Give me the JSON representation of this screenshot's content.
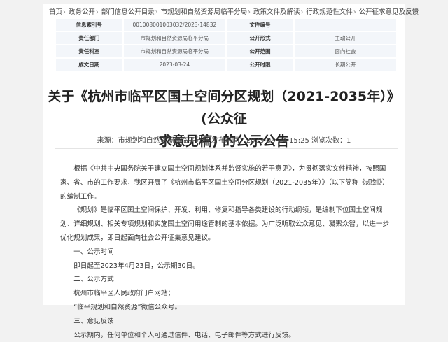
{
  "breadcrumb": [
    "首页",
    "政务公开",
    "部门信息公开目录",
    "市规划和自然资源局临平分局",
    "政策文件及解读",
    "行政规范性文件",
    "公开征求意见及反馈"
  ],
  "meta_table": [
    [
      "信息索引号",
      "001008001003032/2023-14832",
      "文件编号",
      ""
    ],
    [
      "责任部门",
      "市规划和自然资源局临平分局",
      "公开形式",
      "主动公开"
    ],
    [
      "责任科室",
      "市规划和自然资源局临平分局",
      "公开范围",
      "面向社会"
    ],
    [
      "成文日期",
      "2023-03-24",
      "公开时限",
      "长期公开"
    ]
  ],
  "title_line1": "关于《杭州市临平区国土空间分区规划（2021-2035年）》(公众征",
  "title_line2": "求意见稿) 的公示公告",
  "source_line": "来源：市规划和自然资源局临平分局 发布时间：2023-03-24 15:25 浏览次数：1",
  "body": {
    "p1": "根据《中共中央国务院关于建立国土空间规划体系并监督实施的若干意见》，为贯彻落实文件精神，按照国家、省、市的工作要求，我区开展了《杭州市临平区国土空间分区规划（2021-2035年）》（以下简称《规划》）的编制工作。",
    "p2": "《规划》是临平区国土空间保护、开发、利用、修复和指导各类建设的行动纲领，是编制下位国土空间规划、详细规划、相关专项规划和实施国土空间用途管制的基本依据。为广泛听取公众意见、凝聚众智，以进一步优化规划成果，即日起面向社会公开征集意见建议。",
    "h1": "一、公示时间",
    "t1": "即日起至2023年4月23日，公示期30日。",
    "h2": "二、公示方式",
    "t2a": "杭州市临平区人民政府门户网站；",
    "t2b": "“临平规划和自然资源”微信公众号。",
    "h3": "三、意见反馈",
    "t3": "公示期内，任何单位和个人可通过信件、电话、电子邮件等方式进行反馈。"
  }
}
